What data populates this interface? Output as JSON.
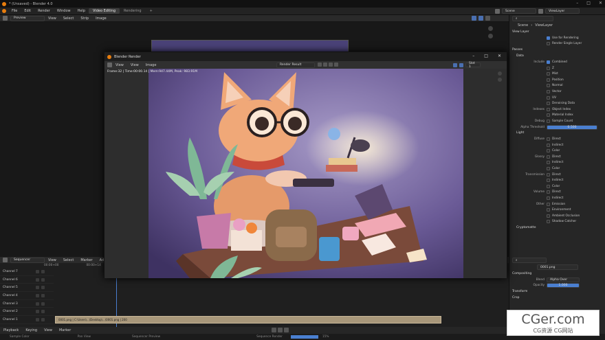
{
  "window_title": "* (Unsaved) - Blender 4.0",
  "menus": [
    "File",
    "Edit",
    "Render",
    "Window",
    "Help"
  ],
  "workspace_tabs": [
    "Video Editing",
    "Rendering"
  ],
  "scene_name": "Scene",
  "view_layer_name": "ViewLayer",
  "seq_header": {
    "mode": "Preview",
    "menus": [
      "View",
      "Select",
      "Strip",
      "Image"
    ]
  },
  "render_window": {
    "title": "Blender Render",
    "menus": [
      "View",
      "View",
      "Image"
    ],
    "slot_name": "Render Result",
    "slot": "Slot 1",
    "info": "Frame:32 | Time:00:00.14 | Mem:947.44M, Peak: 983.91M"
  },
  "props": {
    "breadcrumb": [
      "Scene",
      "ViewLayer"
    ],
    "view_layer_title": "View Layer",
    "use_for_rendering": "Use for Rendering",
    "render_single_layer": "Render Single Layer",
    "passes_title": "Passes",
    "data_title": "Data",
    "include_label": "Include",
    "include_opts": [
      "Combined",
      "Z",
      "Mist",
      "Position",
      "Normal",
      "Vector",
      "UV",
      "Denoising Data"
    ],
    "indexes_label": "Indexes",
    "indexes_opts": [
      "Object Index",
      "Material Index"
    ],
    "debug_label": "Debug",
    "debug_opt": "Sample Count",
    "alpha_label": "Alpha Threshold",
    "alpha_value": "0.500",
    "light_title": "Light",
    "diffuse_label": "Diffuse",
    "diffuse_opts": [
      "Direct",
      "Indirect",
      "Color"
    ],
    "glossy_label": "Glossy",
    "glossy_opts": [
      "Direct",
      "Indirect",
      "Color"
    ],
    "transmission_label": "Transmission",
    "transmission_opts": [
      "Direct",
      "Indirect",
      "Color"
    ],
    "volume_label": "Volume",
    "volume_opts": [
      "Direct",
      "Indirect"
    ],
    "other_label": "Other",
    "other_opts": [
      "Emission",
      "Environment",
      "Ambient Occlusion",
      "Shadow Catcher"
    ],
    "crypto_title": "Cryptomatte"
  },
  "sequencer": {
    "mode": "Sequencer",
    "menus": [
      "View",
      "Select",
      "Marker",
      "Add"
    ],
    "time_start": "00:00+00",
    "time_mid": "00:00+14",
    "channels": [
      "Channel 7",
      "Channel 6",
      "Channel 5",
      "Channel 4",
      "Channel 3",
      "Channel 2",
      "Channel 1"
    ],
    "strip_label": "0001.png | C:\\Users\\...\\Desktop\\...\\0001.png | 200"
  },
  "strip_props": {
    "name": "0001.png",
    "compositing_title": "Compositing",
    "blend_label": "Blend",
    "blend_value": "Alpha Over",
    "opacity_label": "Opacity",
    "opacity_value": "1.000",
    "transform_title": "Transform",
    "crop_title": "Crop"
  },
  "playback": {
    "menus": [
      "Playback",
      "Keying",
      "View",
      "Marker"
    ]
  },
  "status": {
    "left": "Sample Color",
    "mid": "Pan View",
    "right": "Sequencer Preview",
    "render": "Sequence Render",
    "percent": "15%"
  },
  "watermark": {
    "main": "CGer.com",
    "sub": "CG资源 CG网站"
  }
}
